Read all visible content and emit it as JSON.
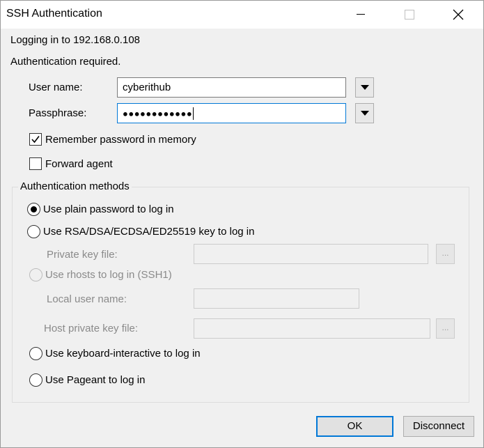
{
  "window": {
    "title": "SSH Authentication",
    "controls": [
      "minimize-icon",
      "maximize-icon",
      "close-icon"
    ]
  },
  "status": {
    "logging_in": "Logging in to 192.168.0.108",
    "auth_required": "Authentication required."
  },
  "form": {
    "username_label": "User name:",
    "username_value": "cyberithub",
    "passphrase_label": "Passphrase:",
    "passphrase_masked": "●●●●●●●●●●●●",
    "remember_label": "Remember password in memory",
    "remember_checked": true,
    "forward_agent_label": "Forward agent",
    "forward_agent_checked": false
  },
  "methods": {
    "group_label": "Authentication methods",
    "plain_password": "Use plain password to log in",
    "rsa_key": "Use RSA/DSA/ECDSA/ED25519 key to log in",
    "private_key_file_label": "Private key file:",
    "browse_label": "...",
    "rhosts": "Use rhosts to log in (SSH1)",
    "local_user_label": "Local user name:",
    "host_private_key_label": "Host private key file:",
    "keyboard_interactive": "Use keyboard-interactive to log in",
    "pageant": "Use Pageant to log in",
    "selected": "plain_password"
  },
  "buttons": {
    "ok": "OK",
    "disconnect": "Disconnect"
  },
  "colors": {
    "focus_border": "#0078d7",
    "window_bg": "#f0f0f0",
    "disabled_text": "#8a8a8a"
  }
}
